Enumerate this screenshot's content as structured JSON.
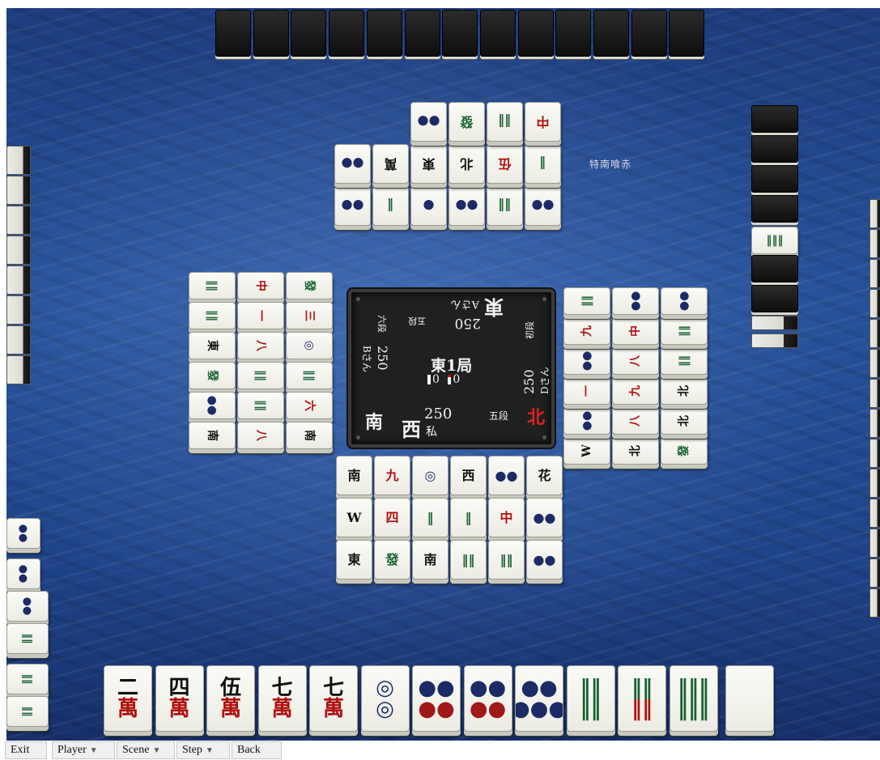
{
  "table": {
    "rules_label": "特南喰赤",
    "round_label": "東1局",
    "honba": "0",
    "riichi_sticks": "0",
    "seats": {
      "east": {
        "wind": "東",
        "name": "Aさん",
        "score": "250",
        "rank": "五段"
      },
      "south": {
        "wind": "南",
        "name": "Bさん",
        "score": "250",
        "rank": "六段"
      },
      "west": {
        "wind": "西",
        "name": "私",
        "score": "250",
        "rank": "五段"
      },
      "north": {
        "wind": "北",
        "name": "Dさん",
        "score": "250",
        "rank": "初段"
      }
    }
  },
  "hand": {
    "tiles": [
      {
        "top": "二",
        "bottom": "萬",
        "color": "#111111",
        "suit_color": "#b01010",
        "icon": "2-man"
      },
      {
        "top": "四",
        "bottom": "萬",
        "color": "#111111",
        "suit_color": "#b01010",
        "icon": "4-man"
      },
      {
        "top": "伍",
        "bottom": "萬",
        "color": "#111111",
        "suit_color": "#b01010",
        "icon": "5-man-red"
      },
      {
        "top": "七",
        "bottom": "萬",
        "color": "#111111",
        "suit_color": "#b01010",
        "icon": "7-man"
      },
      {
        "top": "七",
        "bottom": "萬",
        "color": "#111111",
        "suit_color": "#b01010",
        "icon": "7-man"
      },
      {
        "top": "◎",
        "bottom": "◎",
        "color": "#1c2a66",
        "suit_color": "#1c2a66",
        "icon": "2-pin"
      },
      {
        "top": "●●",
        "bottom": "●●",
        "color": "#1c2a66",
        "suit_color": "#a01818",
        "icon": "6-pin"
      },
      {
        "top": "●●",
        "bottom": "●●",
        "color": "#1c2a66",
        "suit_color": "#a01818",
        "icon": "6-pin"
      },
      {
        "top": "●●",
        "bottom": "●●●",
        "color": "#1c2a66",
        "suit_color": "#1c2a66",
        "icon": "8-pin"
      },
      {
        "top": "‖‖",
        "bottom": "‖‖",
        "color": "#176030",
        "suit_color": "#176030",
        "icon": "4-sou"
      },
      {
        "top": "‖‖",
        "bottom": "‖‖",
        "color": "#176030",
        "suit_color": "#b01010",
        "icon": "5-sou"
      },
      {
        "top": "‖‖‖",
        "bottom": "‖‖‖",
        "color": "#176030",
        "suit_color": "#176030",
        "icon": "6-sou"
      },
      {
        "top": "",
        "bottom": "",
        "color": "#111111",
        "suit_color": "#111111",
        "icon": "white-dragon"
      }
    ]
  },
  "discards": {
    "top": [
      "●●",
      "‖‖",
      "●●",
      "●",
      "‖",
      "●●",
      "‖",
      "伍",
      "北",
      "東",
      "萬",
      "●●",
      "中",
      "‖‖",
      "發",
      "●●"
    ],
    "left": [
      "發",
      "三",
      "◎",
      "‖‖",
      "六",
      "南",
      "中",
      "一",
      "八",
      "‖‖",
      "‖‖",
      "八",
      "‖‖",
      "‖‖",
      "東",
      "發",
      "●●",
      "南"
    ],
    "right": [
      "W",
      "●●",
      "一",
      "●●",
      "九",
      "‖‖",
      "北",
      "八",
      "九",
      "八",
      "中",
      "●●",
      "發",
      "北",
      "北",
      "‖‖",
      "‖‖",
      "●●"
    ],
    "bottom": [
      "南",
      "九",
      "◎",
      "西",
      "●●",
      "花",
      "W",
      "四",
      "‖",
      "‖",
      "中",
      "●●",
      "東",
      "發",
      "南",
      "‖‖",
      "‖‖",
      "●●"
    ]
  },
  "toolbar": {
    "exit": "Exit",
    "player": "Player",
    "scene": "Scene",
    "step": "Step",
    "back": "Back"
  },
  "colors": {
    "felt": "#27529a",
    "tile_face": "#f5f5ef",
    "panel": "#202020",
    "red": "#b01010",
    "blue": "#1c2a66",
    "green": "#176030"
  }
}
